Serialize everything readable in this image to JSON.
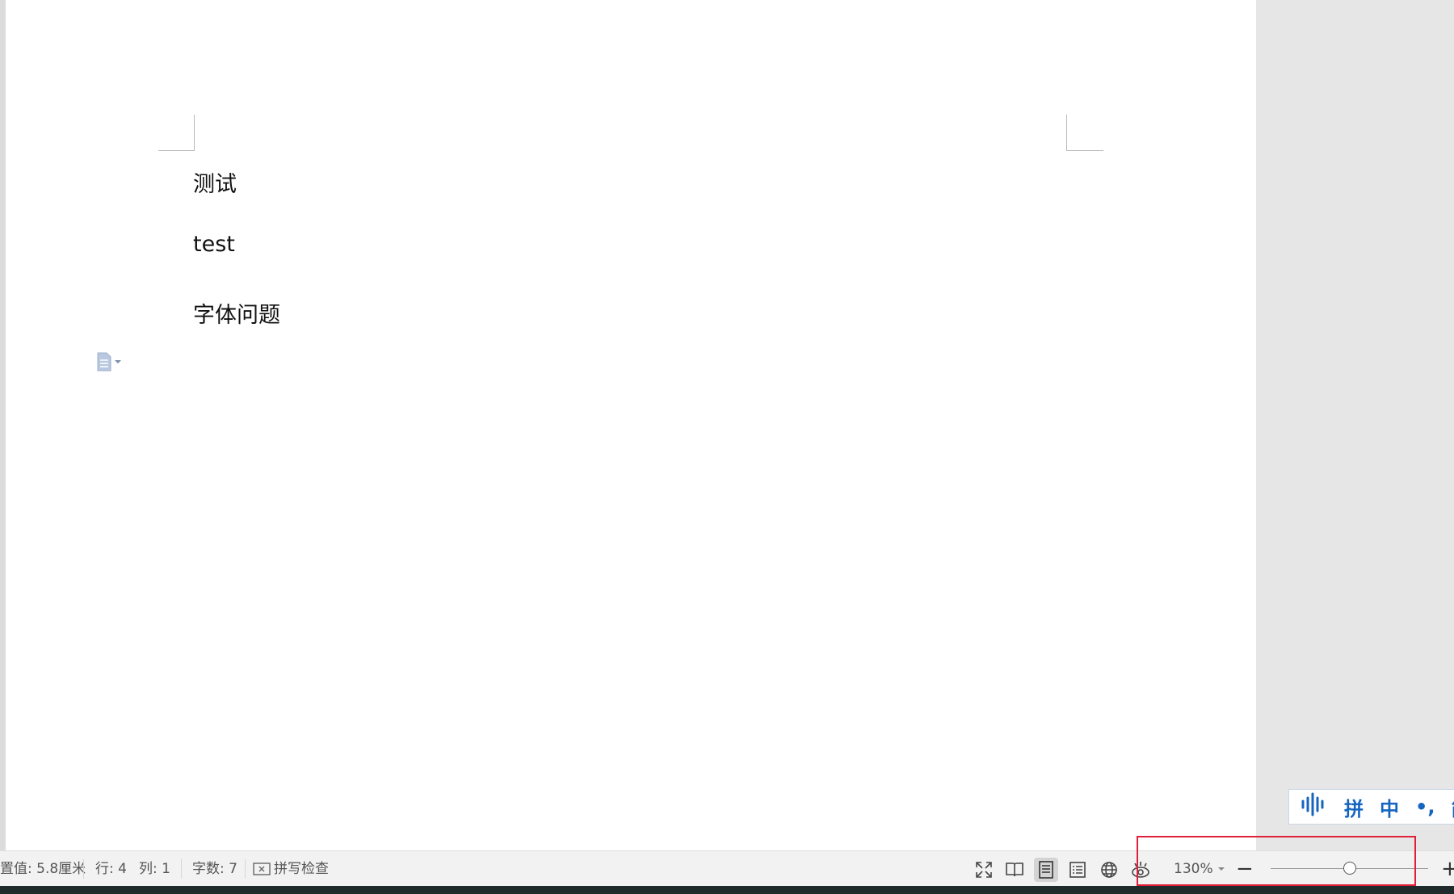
{
  "document": {
    "paragraphs": [
      "测试",
      "test",
      "字体问题"
    ]
  },
  "ime": {
    "voice_icon": "voice-waveform-icon",
    "mode": "拼",
    "lang": "中",
    "punct": "•,",
    "extra": "简"
  },
  "status": {
    "setting_value": "置值: 5.8厘米",
    "line": "行: 4",
    "column": "列: 1",
    "word_count": "字数: 7",
    "spell_check": "拼写检查"
  },
  "views": {
    "icons": [
      "fullscreen-icon",
      "read-mode-icon",
      "page-view-icon",
      "outline-view-icon",
      "web-view-icon",
      "eye-protection-icon"
    ],
    "active": "page-view-icon"
  },
  "zoom": {
    "label": "130%",
    "minus": "−",
    "plus": "+",
    "slider_fraction": 0.5
  },
  "colors": {
    "highlight": "#e0203a",
    "ime_accent": "#1565c0"
  }
}
